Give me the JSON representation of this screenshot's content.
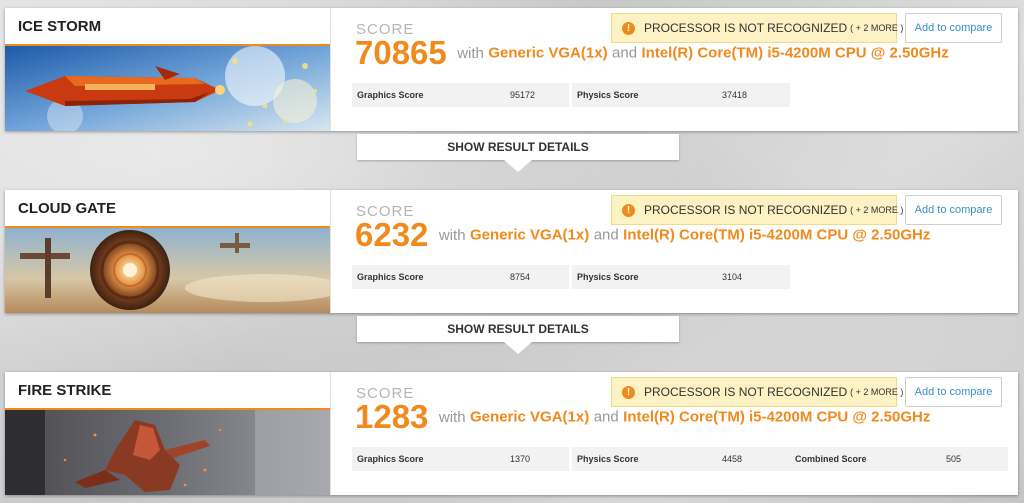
{
  "results": [
    {
      "test_name": "ICE STORM",
      "score_label": "SCORE",
      "score": "70865",
      "with_text": "with",
      "gpu": "Generic VGA(1x)",
      "and_text": "and",
      "cpu": "Intel(R) Core(TM) i5-4200M CPU @ 2.50GHz",
      "warning": "PROCESSOR IS NOT RECOGNIZED",
      "warning_more": "( + 2 MORE )",
      "compare_label": "Add to compare",
      "metrics": [
        {
          "label": "Graphics Score",
          "value": "95172"
        },
        {
          "label": "Physics Score",
          "value": "37418"
        }
      ],
      "details_label": "SHOW RESULT DETAILS"
    },
    {
      "test_name": "CLOUD GATE",
      "score_label": "SCORE",
      "score": "6232",
      "with_text": "with",
      "gpu": "Generic VGA(1x)",
      "and_text": "and",
      "cpu": "Intel(R) Core(TM) i5-4200M CPU @ 2.50GHz",
      "warning": "PROCESSOR IS NOT RECOGNIZED",
      "warning_more": "( + 2 MORE )",
      "compare_label": "Add to compare",
      "metrics": [
        {
          "label": "Graphics Score",
          "value": "8754"
        },
        {
          "label": "Physics Score",
          "value": "3104"
        }
      ],
      "details_label": "SHOW RESULT DETAILS"
    },
    {
      "test_name": "FIRE STRIKE",
      "score_label": "SCORE",
      "score": "1283",
      "with_text": "with",
      "gpu": "Generic VGA(1x)",
      "and_text": "and",
      "cpu": "Intel(R) Core(TM) i5-4200M CPU @ 2.50GHz",
      "warning": "PROCESSOR IS NOT RECOGNIZED",
      "warning_more": "( + 2 MORE )",
      "compare_label": "Add to compare",
      "metrics": [
        {
          "label": "Graphics Score",
          "value": "1370"
        },
        {
          "label": "Physics Score",
          "value": "4458"
        },
        {
          "label": "Combined Score",
          "value": "505"
        }
      ]
    }
  ],
  "icons": {
    "warning": "exclamation-circle-icon",
    "details": "chevron-down-icon"
  },
  "colors": {
    "accent": "#f08a1c",
    "link": "#3a8fc7",
    "warning_bg": "#fdf2c3"
  }
}
